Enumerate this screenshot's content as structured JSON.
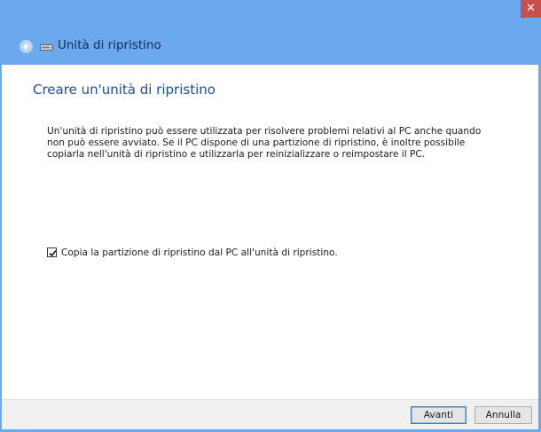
{
  "window": {
    "close_glyph": "✕"
  },
  "nav": {
    "back_icon": "back-arrow-icon",
    "drive_icon": "usb-drive-icon",
    "title": "Unità di ripristino"
  },
  "content": {
    "heading": "Creare un'unità di ripristino",
    "description": "Un'unità di ripristino può essere utilizzata per risolvere problemi relativi al PC anche quando non può essere avviato. Se il PC dispone di una partizione di ripristino, è inoltre possibile copiarla nell'unità di ripristino e utilizzarla per reinizializzare o reimpostare il PC.",
    "checkbox": {
      "label": "Copia la partizione di ripristino dal PC all'unità di ripristino.",
      "checked": true
    }
  },
  "footer": {
    "next_label": "Avanti",
    "cancel_label": "Annulla"
  },
  "colors": {
    "chrome": "#6aa9ee",
    "close": "#c7504a",
    "heading": "#1e4da1"
  }
}
